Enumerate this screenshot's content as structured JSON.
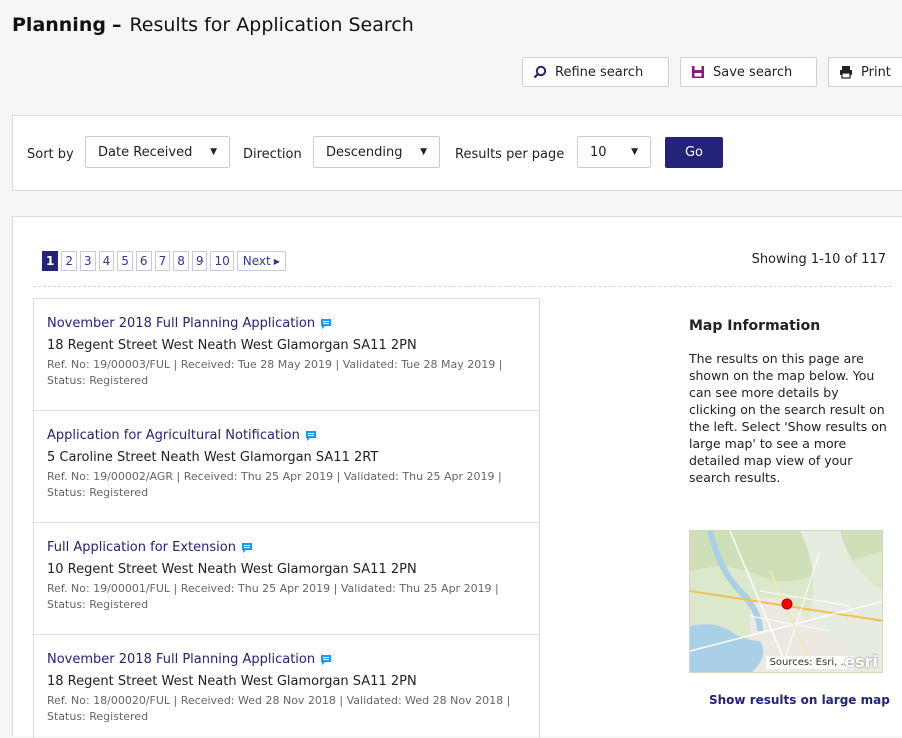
{
  "header": {
    "app": "Planning",
    "separator": "–",
    "title": "Results for Application Search"
  },
  "actions": {
    "refine": "Refine search",
    "save": "Save search",
    "print": "Print"
  },
  "sort": {
    "sort_by_label": "Sort by",
    "sort_by_value": "Date Received",
    "direction_label": "Direction",
    "direction_value": "Descending",
    "per_page_label": "Results per page",
    "per_page_value": "10",
    "go": "Go"
  },
  "pager": {
    "pages": [
      "1",
      "2",
      "3",
      "4",
      "5",
      "6",
      "7",
      "8",
      "9",
      "10"
    ],
    "next": "Next",
    "showing": "Showing 1-10 of 117"
  },
  "results": [
    {
      "title": "November 2018 Full Planning Application",
      "address": "18 Regent Street West Neath West Glamorgan SA11 2PN",
      "meta": "Ref. No: 19/00003/FUL | Received: Tue 28 May 2019 | Validated: Tue 28 May 2019 | Status: Registered"
    },
    {
      "title": "Application for Agricultural Notification",
      "address": "5 Caroline Street Neath West Glamorgan SA11 2RT",
      "meta": "Ref. No: 19/00002/AGR | Received: Thu 25 Apr 2019 | Validated: Thu 25 Apr 2019 | Status: Registered"
    },
    {
      "title": "Full Application for Extension",
      "address": "10 Regent Street West Neath West Glamorgan SA11 2PN",
      "meta": "Ref. No: 19/00001/FUL | Received: Thu 25 Apr 2019 | Validated: Thu 25 Apr 2019 | Status: Registered"
    },
    {
      "title": "November 2018 Full Planning Application",
      "address": "18 Regent Street West Neath West Glamorgan SA11 2PN",
      "meta": "Ref. No: 18/00020/FUL | Received: Wed 28 Nov 2018 | Validated: Wed 28 Nov 2018 | Status: Registered"
    }
  ],
  "map": {
    "heading": "Map Information",
    "text": "The results on this page are shown on the map below. You can see more details by clicking on the search result on the left. Select 'Show results on large map' to see a more detailed map view of your search results.",
    "attribution": "Sources: Esri, ...",
    "logo": "esri",
    "large_link": "Show results on large map",
    "marker_color": "#ff0000"
  },
  "colors": {
    "accent": "#23237a",
    "comment_icon": "#1e9be0"
  }
}
